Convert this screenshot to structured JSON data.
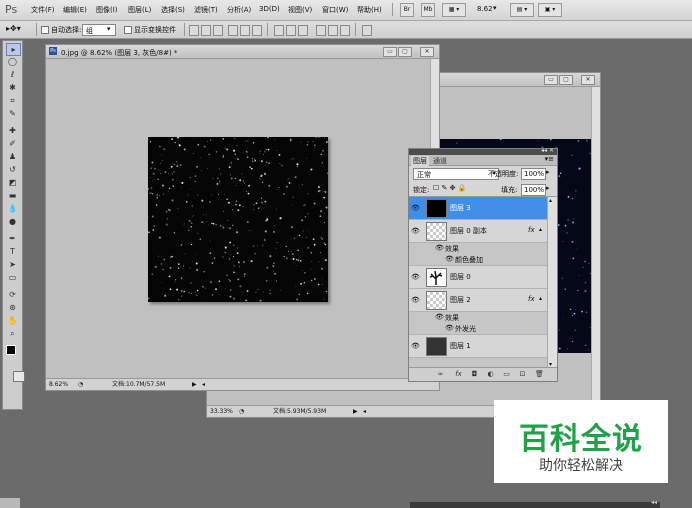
{
  "app": {
    "logo": "Ps"
  },
  "menu": [
    "文件(F)",
    "编辑(E)",
    "图像(I)",
    "图层(L)",
    "选择(S)",
    "滤镜(T)",
    "分析(A)",
    "3D(D)",
    "视图(V)",
    "窗口(W)",
    "帮助(H)"
  ],
  "menu_right": {
    "zoom": "8.62"
  },
  "options": {
    "auto_select_label": "自动选择:",
    "auto_select_value": "组",
    "show_transform_label": "显示变换控件"
  },
  "doc1": {
    "title": "0.jpg @ 8.62% (图层 3, 灰色/8#) *",
    "zoom": "8.62%",
    "doc_info": "文档:10.7M/57.5M"
  },
  "doc2": {
    "zoom": "33.33%",
    "doc_info": "文档:5.93M/5.93M"
  },
  "layers": {
    "tabs": [
      "图层",
      "通道"
    ],
    "blend_mode": "正常",
    "opacity_label": "不透明度:",
    "opacity": "100%",
    "lock_label": "锁定:",
    "fill_label": "填充:",
    "fill": "100%",
    "items": [
      {
        "name": "图层 3"
      },
      {
        "name": "图层 0 副本",
        "fx": "fx",
        "effects_label": "效果",
        "effect": "颜色叠加"
      },
      {
        "name": "图层 0"
      },
      {
        "name": "图层 2",
        "fx": "fx",
        "effects_label": "效果",
        "effect": "外发光"
      },
      {
        "name": "图层 1"
      }
    ]
  },
  "watermark": {
    "title": "百科全说",
    "subtitle": "助你轻松解决"
  },
  "colors": {
    "accent_selected": "#3f8ee8",
    "watermark_green": "#22a14a"
  }
}
